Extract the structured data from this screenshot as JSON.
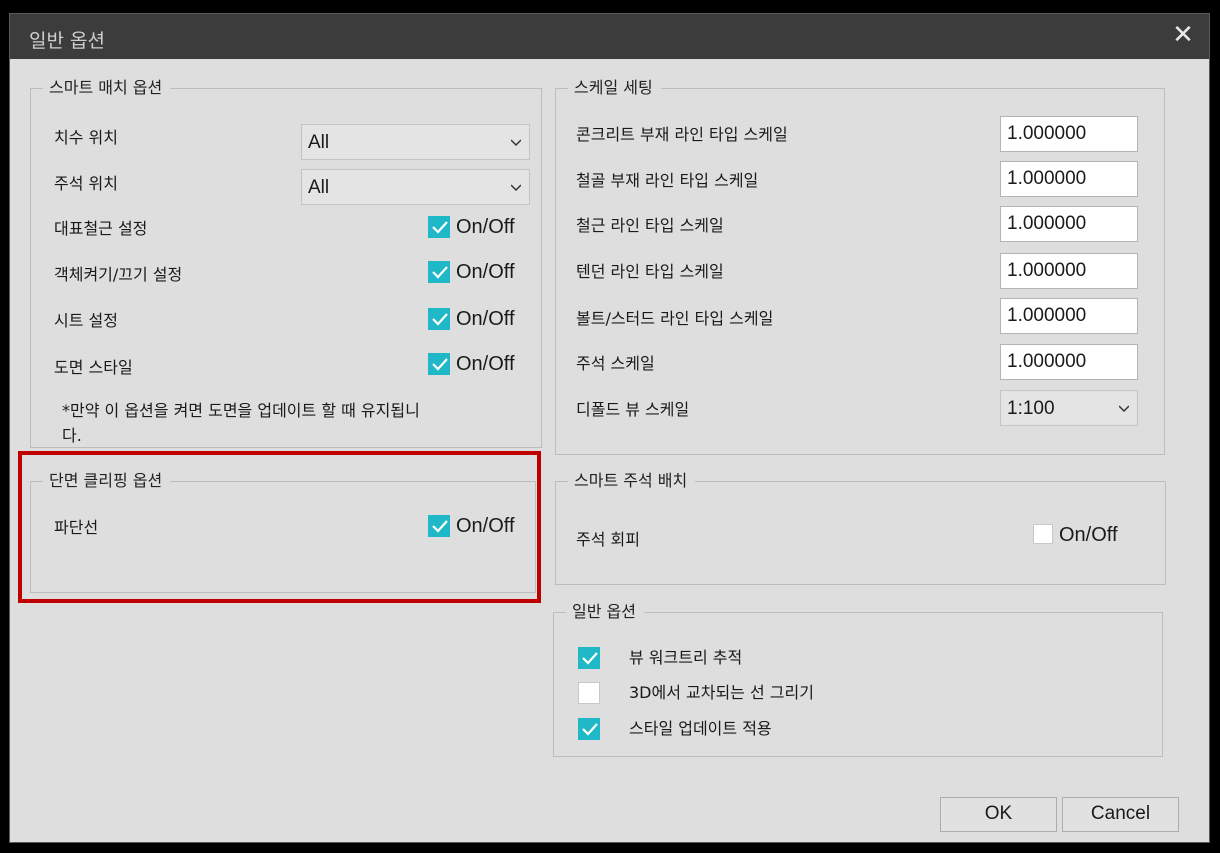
{
  "window": {
    "title": "일반 옵션",
    "close_label": "✕"
  },
  "smart_match": {
    "title": "스마트 매치 옵션",
    "dim_position": {
      "label": "치수 위치",
      "value": "All"
    },
    "note_position": {
      "label": "주석 위치",
      "value": "All"
    },
    "rebar_setting": {
      "label": "대표철근 설정",
      "check": "On/Off",
      "checked": true
    },
    "hide_show_setting": {
      "label": "객체켜기/끄기 설정",
      "check": "On/Off",
      "checked": true
    },
    "sheet_setting": {
      "label": "시트 설정",
      "check": "On/Off",
      "checked": true
    },
    "drawing_style": {
      "label": "도면 스타일",
      "check": "On/Off",
      "checked": true
    },
    "note": "*만약 이 옵션을 켜면 도면을 업데이트 할 때 유지됩니",
    "note2": "다."
  },
  "section_clip": {
    "title": "단면 클리핑 옵션",
    "break_line": {
      "label": "파단선",
      "check": "On/Off",
      "checked": true
    }
  },
  "scale_setting": {
    "title": "스케일 세팅",
    "concrete": {
      "label": "콘크리트 부재 라인 타입 스케일",
      "value": "1.000000"
    },
    "steel": {
      "label": "철골 부재 라인 타입 스케일",
      "value": "1.000000"
    },
    "rebar": {
      "label": "철근 라인 타입 스케일",
      "value": "1.000000"
    },
    "tendon": {
      "label": "텐던 라인 타입 스케일",
      "value": "1.000000"
    },
    "bolt": {
      "label": "볼트/스터드 라인 타입 스케일",
      "value": "1.000000"
    },
    "note": {
      "label": "주석 스케일",
      "value": "1.000000"
    },
    "default_view": {
      "label": "디폴드 뷰 스케일",
      "value": "1:100"
    }
  },
  "smart_note": {
    "title": "스마트 주석 배치",
    "avoid": {
      "label": "주석 회피",
      "check": "On/Off",
      "checked": false
    }
  },
  "general": {
    "title": "일반 옵션",
    "view_worktree": {
      "label": "뷰 워크트리 추적",
      "checked": true
    },
    "draw_3d": {
      "label": "3D에서 교차되는 선 그리기",
      "checked": false
    },
    "apply_style": {
      "label": "스타일 업데이트 적용",
      "checked": true
    }
  },
  "buttons": {
    "ok": "OK",
    "cancel": "Cancel"
  },
  "colors": {
    "check_accent": "#1fb8c6",
    "highlight": "#c00000",
    "titlebar": "#3c3c3c"
  }
}
